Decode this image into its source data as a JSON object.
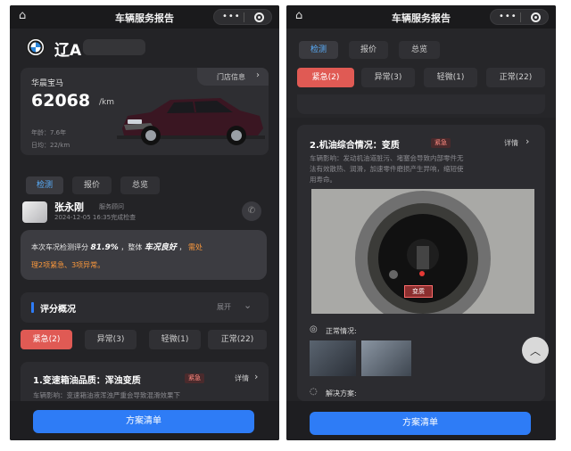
{
  "colors": {
    "primary": "#2e7cf6",
    "urgent": "#e05a54",
    "highlight": "#ff9a3c",
    "background": "#232326"
  },
  "left_panel": {
    "topbar": {
      "home_icon": "home-icon",
      "title": "车辆服务报告",
      "dots": "•••"
    },
    "car": {
      "brand_logo": "bmw-logo",
      "plate": "辽A",
      "model": "华晨宝马",
      "store_link": "门店信息",
      "mileage": "62068",
      "unit": "/km",
      "yearly": "年龄：7.6年",
      "daily": "日均：22/km"
    },
    "tabs": [
      "检测",
      "报价",
      "总览"
    ],
    "advisor": {
      "name": "张永刚",
      "role": "服务顾问",
      "time": "2024-12-05 16:35完成检查"
    },
    "summary": {
      "prefix": "本次车况检测评分",
      "score": "81.9%",
      "mid": "，整体",
      "condition": "车况良好",
      "comma": "，",
      "issues_line1": "需处",
      "issues_line2": "理2项紧急、3项异常。"
    },
    "overview": {
      "title": "评分概况",
      "toggle": "展开"
    },
    "segments": [
      "紧急(2)",
      "异常(3)",
      "轻微(1)",
      "正常(22)"
    ],
    "item": {
      "title": "1.变速箱油品质：浑浊变质",
      "badge": "紧急",
      "detail": "详情",
      "desc": "车辆影响：变速箱油液浑浊严重会导致混滑效果下"
    },
    "cta": "方案清单"
  },
  "right_panel": {
    "topbar": {
      "title": "车辆服务报告",
      "dots": "•••"
    },
    "tabs": [
      "检测",
      "报价",
      "总览"
    ],
    "segments": [
      "紧急(2)",
      "异常(3)",
      "轻微(1)",
      "正常(22)"
    ],
    "item": {
      "title": "2.机油综合情况：变质",
      "badge": "紧急",
      "detail": "详情",
      "desc": [
        "车辆影响：发动机油道脏污、堵塞会导致内部零件无",
        "法有效散热、润滑，加速零件磨损产生异响，缩短使",
        "用寿命。"
      ],
      "photo_tag": "变质"
    },
    "normal_label": "正常情况:",
    "solution_label": "解决方案:",
    "cta": "方案清单"
  }
}
